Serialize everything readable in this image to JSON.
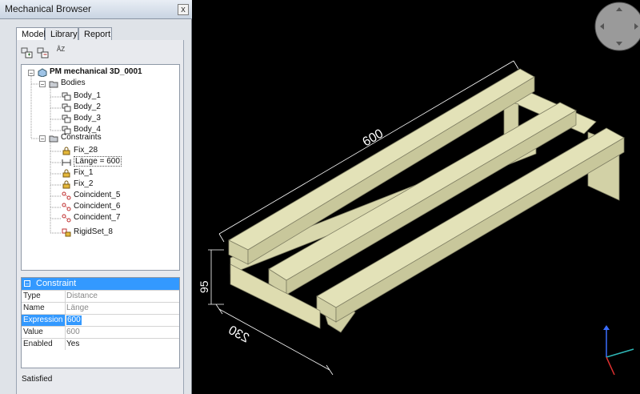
{
  "window": {
    "title": "Mechanical Browser",
    "close_glyph": "x"
  },
  "tabs": [
    {
      "label": "Model",
      "active": true
    },
    {
      "label": "Library"
    },
    {
      "label": "Report"
    }
  ],
  "toolbar": {
    "buttons": [
      "add-component-icon",
      "remove-component-icon",
      "sort-icon"
    ],
    "sort_glyph": "ÅZ"
  },
  "tree": {
    "root": "PM mechanical 3D_0001",
    "bodies_label": "Bodies",
    "bodies": [
      "Body_1",
      "Body_2",
      "Body_3",
      "Body_4"
    ],
    "constraints_label": "Constraints",
    "constraints": [
      "Fix_28",
      "Länge = 600",
      "Fix_1",
      "Fix_2",
      "Coincident_5",
      "Coincident_6",
      "Coincident_7",
      "RigidSet_8"
    ]
  },
  "properties": {
    "header": "Constraint",
    "rows": [
      {
        "key": "Type",
        "value": "Distance"
      },
      {
        "key": "Name",
        "value": "Länge"
      },
      {
        "key": "Expression",
        "value": "600"
      },
      {
        "key": "Value",
        "value": "600"
      },
      {
        "key": "Enabled",
        "value": "Yes"
      }
    ]
  },
  "status": "Satisfied",
  "dimensions": {
    "length": "600",
    "height": "95",
    "width": "230"
  },
  "colors": {
    "model": "#e3e2b8",
    "selection": "#3399ff",
    "background": "#000000"
  }
}
